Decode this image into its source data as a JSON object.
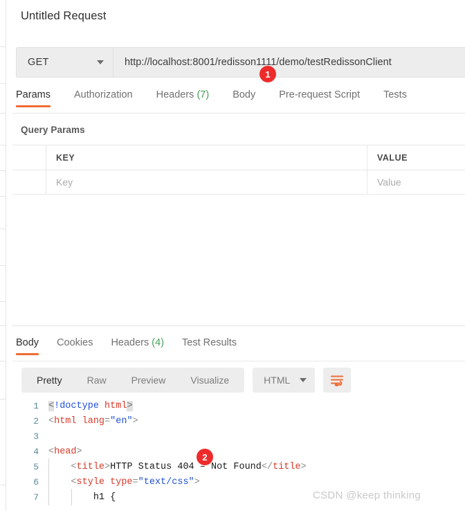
{
  "colors": {
    "accent": "#ef6c32",
    "badge": "#ee2b2b",
    "count_green": "#45a05a",
    "panel_gray": "#ededed",
    "watermark": "#c9c9c9"
  },
  "request": {
    "title": "Untitled Request",
    "method": "GET",
    "method_caret_icon": "chevron-down-icon",
    "url": "http://localhost:8001/redisson1111/demo/testRedissonClient",
    "tabs": [
      {
        "label": "Params",
        "count": "",
        "active": true
      },
      {
        "label": "Authorization",
        "count": "",
        "active": false
      },
      {
        "label": "Headers",
        "count": "(7)",
        "active": false
      },
      {
        "label": "Body",
        "count": "",
        "active": false
      },
      {
        "label": "Pre-request Script",
        "count": "",
        "active": false
      },
      {
        "label": "Tests",
        "count": "",
        "active": false
      }
    ]
  },
  "query_params": {
    "section_title": "Query Params",
    "headers": {
      "key": "KEY",
      "value": "VALUE"
    },
    "rows": [
      {
        "key_placeholder": "Key",
        "value_placeholder": "Value"
      }
    ]
  },
  "response": {
    "tabs": [
      {
        "label": "Body",
        "count": "",
        "active": true
      },
      {
        "label": "Cookies",
        "count": "",
        "active": false
      },
      {
        "label": "Headers",
        "count": "(4)",
        "active": false
      },
      {
        "label": "Test Results",
        "count": "",
        "active": false
      }
    ],
    "view_modes": [
      {
        "label": "Pretty",
        "active": true
      },
      {
        "label": "Raw",
        "active": false
      },
      {
        "label": "Preview",
        "active": false
      },
      {
        "label": "Visualize",
        "active": false
      }
    ],
    "format": {
      "label": "HTML",
      "caret_icon": "chevron-down-icon"
    },
    "wrap_button": {
      "icon": "word-wrap-icon"
    },
    "code": {
      "lines": [
        {
          "n": "1",
          "tokens": [
            {
              "t": "<",
              "c": "brhl"
            },
            {
              "t": "!doctype ",
              "c": "tok-doc"
            },
            {
              "t": "html",
              "c": "tok-tag"
            },
            {
              "t": ">",
              "c": "brhl"
            }
          ]
        },
        {
          "n": "2",
          "tokens": [
            {
              "t": "<",
              "c": "tok-punct"
            },
            {
              "t": "html ",
              "c": "tok-tag"
            },
            {
              "t": "lang",
              "c": "tok-attr"
            },
            {
              "t": "=",
              "c": "tok-punct"
            },
            {
              "t": "\"en\"",
              "c": "tok-str"
            },
            {
              "t": ">",
              "c": "tok-punct"
            }
          ]
        },
        {
          "n": "3",
          "tokens": []
        },
        {
          "n": "4",
          "tokens": [
            {
              "t": "<",
              "c": "tok-punct"
            },
            {
              "t": "head",
              "c": "tok-tag"
            },
            {
              "t": ">",
              "c": "tok-punct"
            }
          ]
        },
        {
          "n": "5",
          "tokens": [
            {
              "t": "    ",
              "c": "tok-text"
            },
            {
              "t": "<",
              "c": "tok-punct"
            },
            {
              "t": "title",
              "c": "tok-tag"
            },
            {
              "t": ">",
              "c": "tok-punct"
            },
            {
              "t": "HTTP Status 404 – Not Found",
              "c": "tok-text"
            },
            {
              "t": "</",
              "c": "tok-punct"
            },
            {
              "t": "title",
              "c": "tok-tag"
            },
            {
              "t": ">",
              "c": "tok-punct"
            }
          ]
        },
        {
          "n": "6",
          "tokens": [
            {
              "t": "    ",
              "c": "tok-text"
            },
            {
              "t": "<",
              "c": "tok-punct"
            },
            {
              "t": "style ",
              "c": "tok-tag"
            },
            {
              "t": "type",
              "c": "tok-attr"
            },
            {
              "t": "=",
              "c": "tok-punct"
            },
            {
              "t": "\"text/css\"",
              "c": "tok-str"
            },
            {
              "t": ">",
              "c": "tok-punct"
            }
          ]
        },
        {
          "n": "7",
          "tokens": [
            {
              "t": "        h1 {",
              "c": "tok-text"
            }
          ]
        }
      ]
    }
  },
  "annotations": [
    {
      "id": "1",
      "label": "1"
    },
    {
      "id": "2",
      "label": "2"
    }
  ],
  "watermark": {
    "text": "CSDN @keep  thinking"
  }
}
